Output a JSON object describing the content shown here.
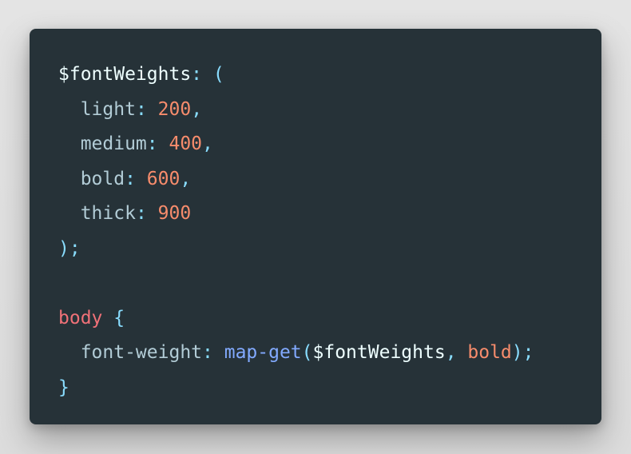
{
  "colors": {
    "background": "#e0e0e0",
    "editor_bg": "#263238",
    "variable": "#eeffff",
    "punctuation": "#89ddff",
    "property": "#b2ccd6",
    "number": "#f78c6c",
    "selector": "#f07178",
    "function": "#82aaff"
  },
  "code": {
    "lines": [
      {
        "tokens": [
          {
            "text": "$fontWeights",
            "kind": "variable"
          },
          {
            "text": ": ",
            "kind": "punctuation"
          },
          {
            "text": "(",
            "kind": "punctuation"
          }
        ]
      },
      {
        "tokens": [
          {
            "text": "  light",
            "kind": "property"
          },
          {
            "text": ": ",
            "kind": "punctuation"
          },
          {
            "text": "200",
            "kind": "number"
          },
          {
            "text": ",",
            "kind": "punctuation"
          }
        ]
      },
      {
        "tokens": [
          {
            "text": "  medium",
            "kind": "property"
          },
          {
            "text": ": ",
            "kind": "punctuation"
          },
          {
            "text": "400",
            "kind": "number"
          },
          {
            "text": ",",
            "kind": "punctuation"
          }
        ]
      },
      {
        "tokens": [
          {
            "text": "  bold",
            "kind": "property"
          },
          {
            "text": ": ",
            "kind": "punctuation"
          },
          {
            "text": "600",
            "kind": "number"
          },
          {
            "text": ",",
            "kind": "punctuation"
          }
        ]
      },
      {
        "tokens": [
          {
            "text": "  thick",
            "kind": "property"
          },
          {
            "text": ": ",
            "kind": "punctuation"
          },
          {
            "text": "900",
            "kind": "number"
          }
        ]
      },
      {
        "tokens": [
          {
            "text": ");",
            "kind": "punctuation"
          }
        ]
      },
      {
        "tokens": []
      },
      {
        "tokens": [
          {
            "text": "body",
            "kind": "selector"
          },
          {
            "text": " ",
            "kind": "punctuation"
          },
          {
            "text": "{",
            "kind": "punctuation"
          }
        ]
      },
      {
        "tokens": [
          {
            "text": "  font-weight",
            "kind": "property"
          },
          {
            "text": ": ",
            "kind": "punctuation"
          },
          {
            "text": "map-get",
            "kind": "function"
          },
          {
            "text": "(",
            "kind": "punctuation"
          },
          {
            "text": "$fontWeights",
            "kind": "variable"
          },
          {
            "text": ", ",
            "kind": "punctuation"
          },
          {
            "text": "bold",
            "kind": "number"
          },
          {
            "text": ");",
            "kind": "punctuation"
          }
        ]
      },
      {
        "tokens": [
          {
            "text": "}",
            "kind": "punctuation"
          }
        ]
      }
    ]
  }
}
